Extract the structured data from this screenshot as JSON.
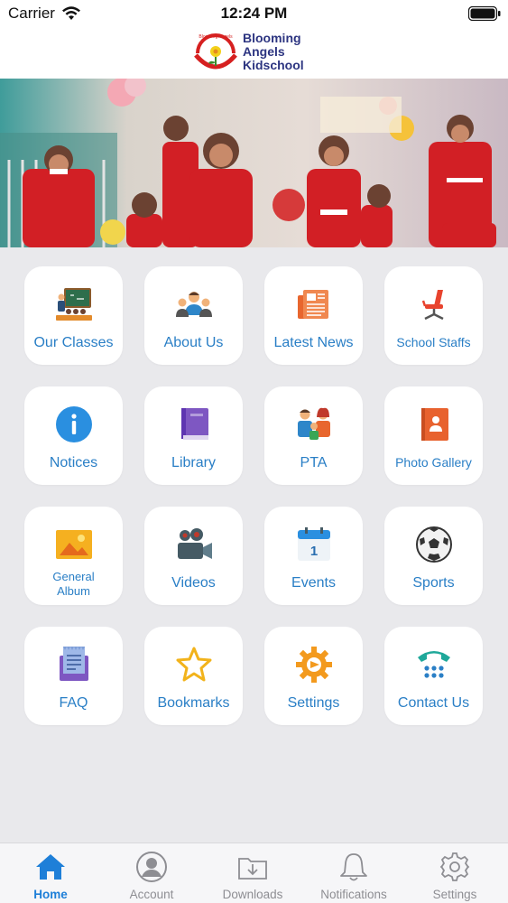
{
  "status_bar": {
    "carrier": "Carrier",
    "time": "12:24 PM"
  },
  "header": {
    "logo_line1": "Blooming",
    "logo_line2": "Angels",
    "logo_line3": "Kidschool",
    "logo_arc_text": "Blooming Angels Kidschool"
  },
  "banner": {
    "slide_count": 3,
    "active_slide": 2
  },
  "menu": [
    {
      "label": "Our Classes",
      "icon": "classroom-icon"
    },
    {
      "label": "About Us",
      "icon": "people-group-icon"
    },
    {
      "label": "Latest News",
      "icon": "newspaper-icon"
    },
    {
      "label": "School Staffs",
      "icon": "chair-icon"
    },
    {
      "label": "Notices",
      "icon": "info-icon"
    },
    {
      "label": "Library",
      "icon": "book-icon"
    },
    {
      "label": "PTA",
      "icon": "family-icon"
    },
    {
      "label": "Photo Gallery",
      "icon": "photo-album-icon"
    },
    {
      "label": "General Album",
      "icon": "image-icon"
    },
    {
      "label": "Videos",
      "icon": "video-camera-icon"
    },
    {
      "label": "Events",
      "icon": "calendar-icon"
    },
    {
      "label": "Sports",
      "icon": "soccer-ball-icon"
    },
    {
      "label": "FAQ",
      "icon": "faq-document-icon"
    },
    {
      "label": "Bookmarks",
      "icon": "star-icon"
    },
    {
      "label": "Settings",
      "icon": "gear-icon"
    },
    {
      "label": "Contact Us",
      "icon": "telephone-icon"
    }
  ],
  "tabs": [
    {
      "label": "Home",
      "icon": "home-icon",
      "active": true
    },
    {
      "label": "Account",
      "icon": "account-icon"
    },
    {
      "label": "Downloads",
      "icon": "downloads-folder-icon"
    },
    {
      "label": "Notifications",
      "icon": "bell-icon"
    },
    {
      "label": "Settings",
      "icon": "settings-gear-icon"
    }
  ],
  "colors": {
    "accent": "#1e7fd8",
    "label_blue": "#2a7fc6",
    "background": "#e9e9ec",
    "logo_text": "#2d3581"
  }
}
